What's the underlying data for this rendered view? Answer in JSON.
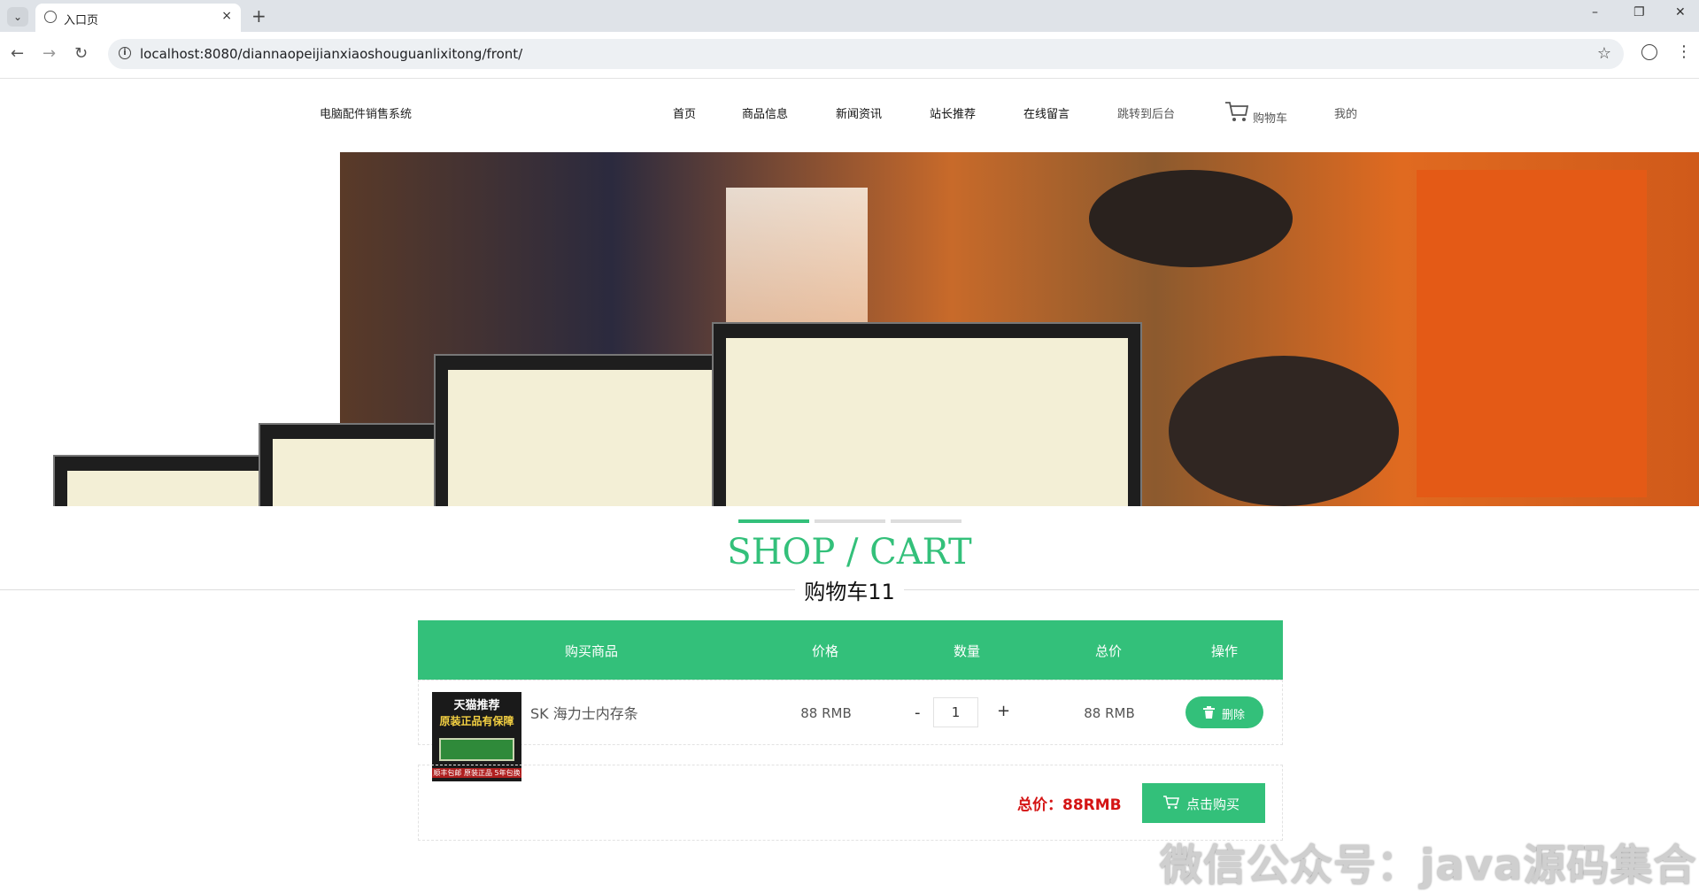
{
  "browser": {
    "tab_title": "入口页",
    "tab_close": "×",
    "new_tab": "+",
    "url": "localhost:8080/diannaopeijianxiaoshouguanlixitong/front/",
    "win_minimize": "–",
    "win_restore": "❐",
    "win_close": "✕",
    "back": "←",
    "forward": "→",
    "reload": "↻",
    "bookmark": "☆",
    "menu": "⋮",
    "tab_list": "⌄"
  },
  "header": {
    "site_name": "电脑配件销售系统",
    "nav": {
      "home": "首页",
      "products": "商品信息",
      "news": "新闻资讯",
      "recommend": "站长推荐",
      "message": "在线留言",
      "backend": "跳转到后台",
      "cart": "购物车",
      "mine": "我的"
    }
  },
  "banner": {
    "slide_count": 3,
    "active_slide": 1
  },
  "page": {
    "title": "SHOP / CART",
    "subtitle": "购物车11"
  },
  "cart": {
    "columns": [
      "购买商品",
      "价格",
      "数量",
      "总价",
      "操作"
    ],
    "items": [
      {
        "name": "SK 海力士内存条",
        "price": "88 RMB",
        "quantity": "1",
        "total": "88 RMB",
        "image_text_top": "天猫推荐",
        "image_text_mid": "原装正品有保障",
        "image_text_bottom": "顺丰包邮 原装正品 5年包换"
      }
    ],
    "minus": "-",
    "plus": "+",
    "delete_label": "删除",
    "grand_total": "总价：88RMB",
    "buy_label": "点击购买"
  },
  "watermark": "微信公众号：java源码集合",
  "colors": {
    "accent": "#33c07a",
    "total": "#d41414"
  }
}
